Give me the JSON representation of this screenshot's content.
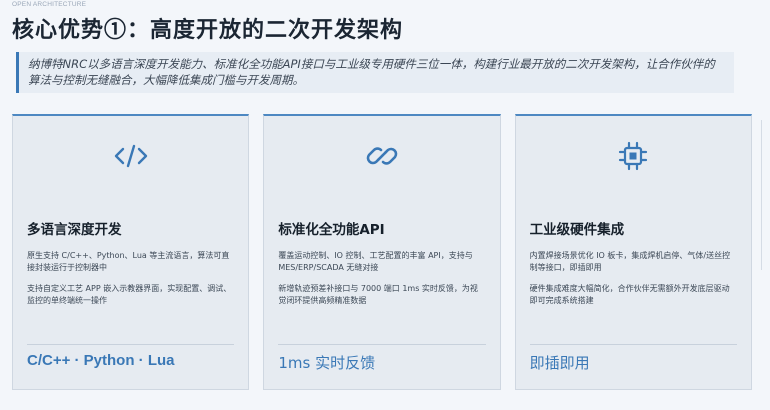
{
  "header": {
    "overline": "OPEN ARCHITECTURE",
    "title": "核心优势①：高度开放的二次开发架构"
  },
  "intro": {
    "text": "纳博特NRC以多语言深度开发能力、标准化全功能API接口与工业级专用硬件三位一体，构建行业最开放的二次开发架构，让合作伙伴的算法与控制无缝融合，大幅降低集成门槛与开发周期。"
  },
  "accent_color": "#3a78b6",
  "cards": [
    {
      "icon": "code-icon",
      "title": "多语言深度开发",
      "text1": "原生支持 C/C++、Python、Lua 等主流语言，算法可直接封装运行于控制器中",
      "text2": "支持自定义工艺 APP 嵌入示教器界面，实现配置、调试、监控的单终端统一操作",
      "footer": "C/C++ · Python · Lua"
    },
    {
      "icon": "link-icon",
      "title": "标准化全功能API",
      "text1": "覆盖运动控制、IO 控制、工艺配置的丰富 API，支持与 MES/ERP/SCADA 无缝对接",
      "text2": "新增轨迹预差补接口与 7000 端口 1ms 实时反馈，为视觉闭环提供高频精准数据",
      "footer": "1ms 实时反馈"
    },
    {
      "icon": "chip-icon",
      "title": "工业级硬件集成",
      "text1": "内置焊接场景优化 IO 板卡，集成焊机启停、气体/送丝控制等接口，即插即用",
      "text2": "硬件集成难度大幅简化，合作伙伴无需额外开发底层驱动即可完成系统搭建",
      "footer": "即插即用"
    }
  ]
}
